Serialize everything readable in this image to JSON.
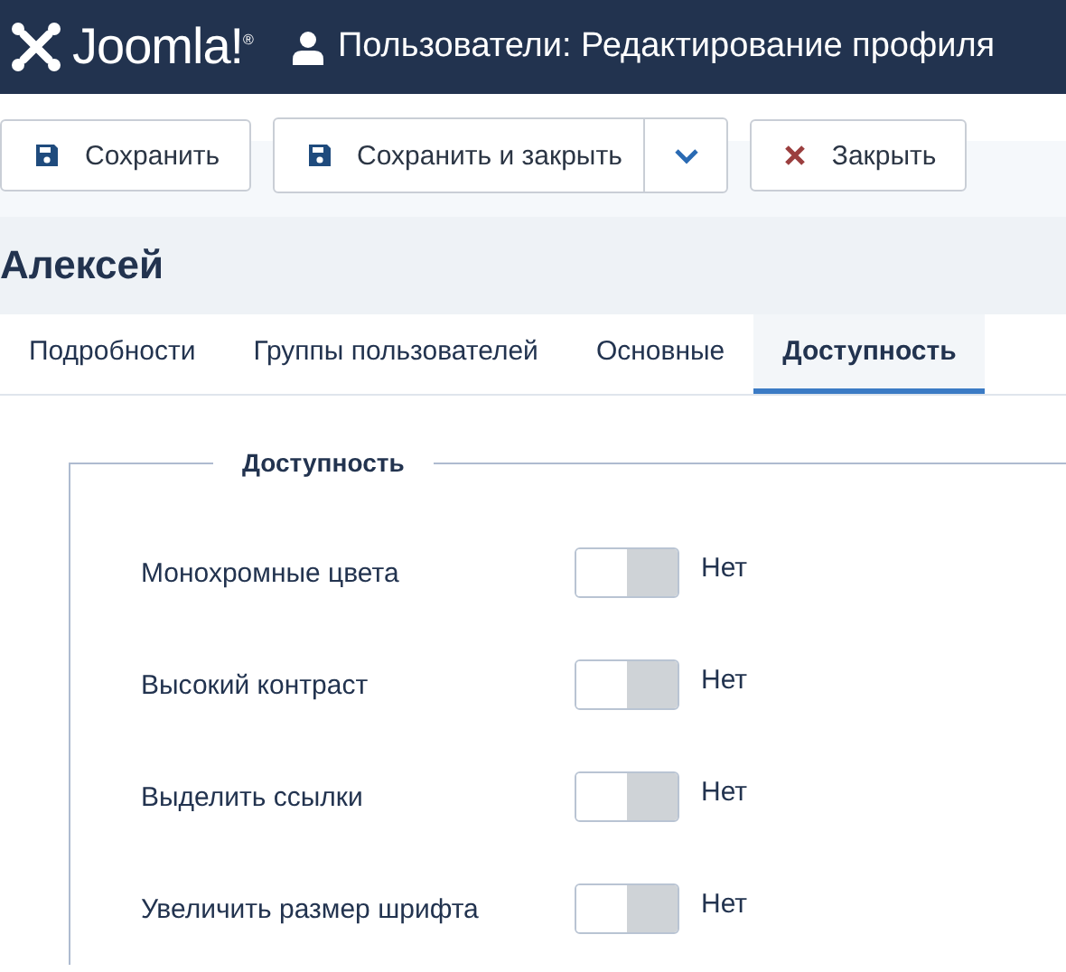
{
  "header": {
    "logo": "Joomla!$^{®}$",
    "title": "Пользователи: Редактирование профиля"
  },
  "toolbar": [
    {
      "kind": "save",
      "label": "Сохранить"
    },
    {
      "kind": "split",
      "label": "Сохранить и закрыть"
    },
    {
      "kind": "close",
      "label": "Закрыть"
    }
  ],
  "page_title": "Алексей",
  "tabs": [
    {
      "label": "Подробности",
      "selected": false
    },
    {
      "label": "Группы пользователей",
      "selected": false
    },
    {
      "label": "Основные",
      "selected": false
    },
    {
      "label": "Доступность",
      "selected": true
    }
  ],
  "fieldset": {
    "legend": "Доступность",
    "options": [
      {
        "label": "Монохромные цвета",
        "on": false,
        "value": "Нет"
      },
      {
        "label": "Высокий контраст",
        "on": false,
        "value": "Нет"
      },
      {
        "label": "Выделить ссылки",
        "on": false,
        "value": "Нет"
      },
      {
        "label": "Увеличить размер шрифта",
        "on": false,
        "value": "Нет"
      }
    ]
  }
}
